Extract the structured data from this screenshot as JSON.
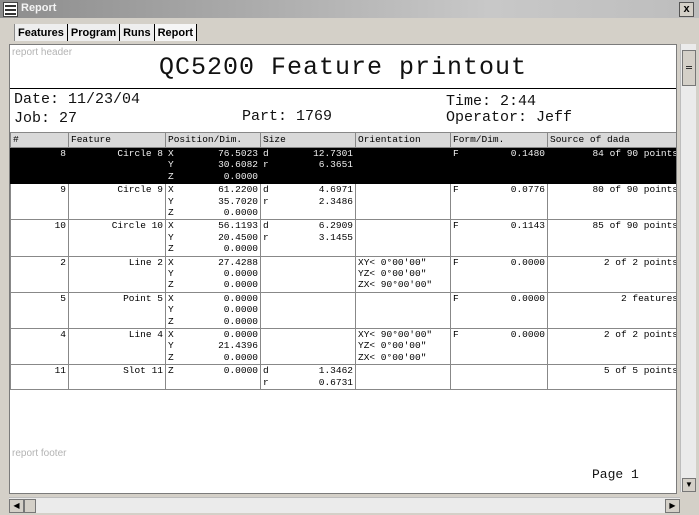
{
  "window": {
    "title": "Report",
    "close_glyph": "x"
  },
  "menu_tabs": [
    "Features",
    "Program",
    "Runs",
    "Report"
  ],
  "report": {
    "header_label": "report header",
    "title": "QC5200 Feature printout",
    "date": "Date: 11/23/04",
    "job": "Job: 27",
    "part": "Part: 1769",
    "time": "Time: 2:44",
    "operator": "Operator: Jeff",
    "footer_label": "report footer",
    "page": "Page 1"
  },
  "columns": [
    "#",
    "Feature",
    "Position/Dim.",
    "Size",
    "Orientation",
    "Form/Dim.",
    "Source of dada"
  ],
  "rows": [
    {
      "num": "8",
      "feature": "Circle 8",
      "pos": [
        [
          "X",
          "76.5023"
        ],
        [
          "Y",
          "30.6082"
        ],
        [
          "Z",
          "0.0000"
        ]
      ],
      "size": [
        [
          "d",
          "12.7301"
        ],
        [
          "r",
          "6.3651"
        ]
      ],
      "orient": [],
      "form": [
        "F",
        "0.1480"
      ],
      "source": "84 of 90 points",
      "selected": true
    },
    {
      "num": "9",
      "feature": "Circle 9",
      "pos": [
        [
          "X",
          "61.2200"
        ],
        [
          "Y",
          "35.7020"
        ],
        [
          "Z",
          "0.0000"
        ]
      ],
      "size": [
        [
          "d",
          "4.6971"
        ],
        [
          "r",
          "2.3486"
        ]
      ],
      "orient": [],
      "form": [
        "F",
        "0.0776"
      ],
      "source": "80 of 90 points"
    },
    {
      "num": "10",
      "feature": "Circle 10",
      "pos": [
        [
          "X",
          "56.1193"
        ],
        [
          "Y",
          "20.4500"
        ],
        [
          "Z",
          "0.0000"
        ]
      ],
      "size": [
        [
          "d",
          "6.2909"
        ],
        [
          "r",
          "3.1455"
        ]
      ],
      "orient": [],
      "form": [
        "F",
        "0.1143"
      ],
      "source": "85 of 90 points"
    },
    {
      "num": "2",
      "feature": "Line 2",
      "pos": [
        [
          "X",
          "27.4288"
        ],
        [
          "Y",
          "0.0000"
        ],
        [
          "Z",
          "0.0000"
        ]
      ],
      "size": [],
      "orient": [
        "XY<  0°00'00\"",
        "YZ<  0°00'00\"",
        "ZX< 90°00'00\""
      ],
      "form": [
        "F",
        "0.0000"
      ],
      "source": "2 of 2 points"
    },
    {
      "num": "5",
      "feature": "Point 5",
      "pos": [
        [
          "X",
          "0.0000"
        ],
        [
          "Y",
          "0.0000"
        ],
        [
          "Z",
          "0.0000"
        ]
      ],
      "size": [],
      "orient": [],
      "form": [
        "F",
        "0.0000"
      ],
      "source": "2 features"
    },
    {
      "num": "4",
      "feature": "Line 4",
      "pos": [
        [
          "X",
          "0.0000"
        ],
        [
          "Y",
          "21.4396"
        ],
        [
          "Z",
          "0.0000"
        ]
      ],
      "size": [],
      "orient": [
        "XY< 90°00'00\"",
        "YZ<  0°00'00\"",
        "ZX<  0°00'00\""
      ],
      "form": [
        "F",
        "0.0000"
      ],
      "source": "2 of 2 points"
    },
    {
      "num": "11",
      "feature": "Slot 11",
      "pos": [
        [
          "Z",
          "0.0000"
        ]
      ],
      "size": [
        [
          "d",
          "1.3462"
        ],
        [
          "r",
          "0.6731"
        ]
      ],
      "orient": [],
      "form": [],
      "source": "5 of 5 points"
    }
  ]
}
